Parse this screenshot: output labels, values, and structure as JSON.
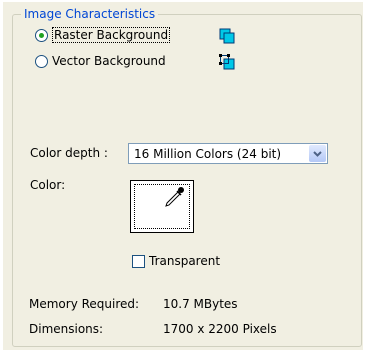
{
  "group": {
    "title": "Image Characteristics"
  },
  "background": {
    "raster_label": "Raster Background",
    "vector_label": "Vector Background",
    "selected": "raster"
  },
  "color_depth": {
    "label": "Color depth :",
    "value": "16 Million Colors (24 bit)"
  },
  "color": {
    "label": "Color:",
    "value": "#ffffff"
  },
  "transparent": {
    "label": "Transparent",
    "checked": false
  },
  "info": {
    "memory_label": "Memory Required:",
    "memory_value": "10.7 MBytes",
    "dimensions_label": "Dimensions:",
    "dimensions_value": "1700 x 2200 Pixels"
  },
  "colors": {
    "group_title": "#0046d5",
    "panel_bg": "#f1efe2",
    "icon_cyan": "#00c8e8"
  },
  "icons": [
    "raster-layer-icon",
    "vector-layer-icon",
    "eyedropper-icon",
    "chevron-down-icon"
  ]
}
